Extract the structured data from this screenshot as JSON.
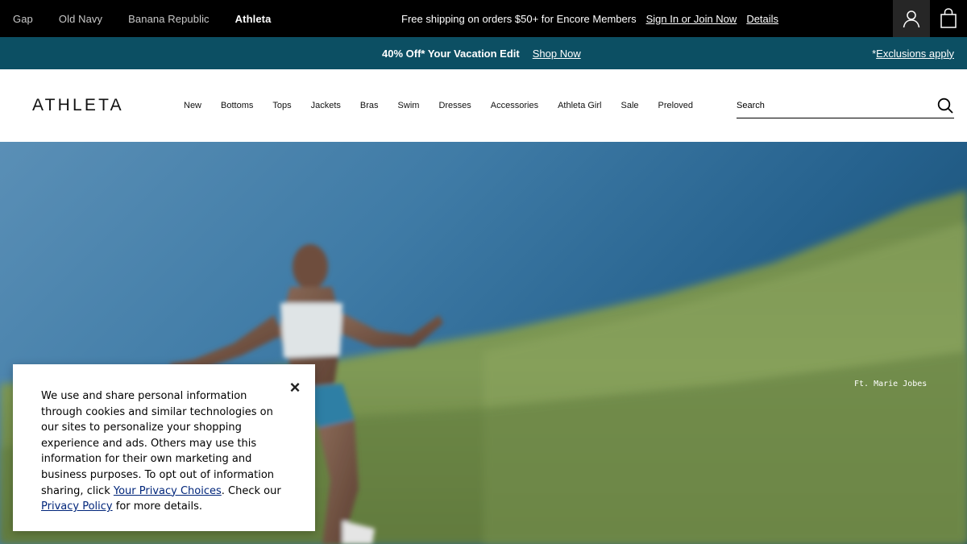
{
  "topbar": {
    "brands": [
      {
        "label": "Gap"
      },
      {
        "label": "Old Navy"
      },
      {
        "label": "Banana Republic"
      },
      {
        "label": "Athleta",
        "active": true
      }
    ],
    "shipping_text": "Free shipping on orders $50+ for Encore Members",
    "sign_in_link": "Sign In or Join Now",
    "details_link": "Details",
    "account_icon": "person-icon",
    "bag_icon": "shopping-bag-icon"
  },
  "promo": {
    "offer": "40% Off* Your Vacation Edit",
    "shop_link": "Shop Now",
    "exclusions_prefix": "*",
    "exclusions_link": "Exclusions apply",
    "background": "#0c4f63"
  },
  "header": {
    "logo": "ATHLETA",
    "nav": [
      "New",
      "Bottoms",
      "Tops",
      "Jackets",
      "Bras",
      "Swim",
      "Dresses",
      "Accessories",
      "Athleta Girl",
      "Sale",
      "Preloved"
    ],
    "search_placeholder": "Search",
    "search_icon": "magnifier-icon"
  },
  "hero": {
    "credit": "Ft. Marie Jobes"
  },
  "cookie_banner": {
    "text_before": "We use and share personal information through cookies and similar technologies on our sites to personalize your shopping experience and ads. Others may use this information for their own marketing and business purposes. To opt out of information sharing, click ",
    "privacy_choices_link": "Your Privacy Choices",
    "text_middle": ". Check our ",
    "privacy_policy_link": "Privacy Policy",
    "text_after": " for more details.",
    "close_label": "×"
  }
}
